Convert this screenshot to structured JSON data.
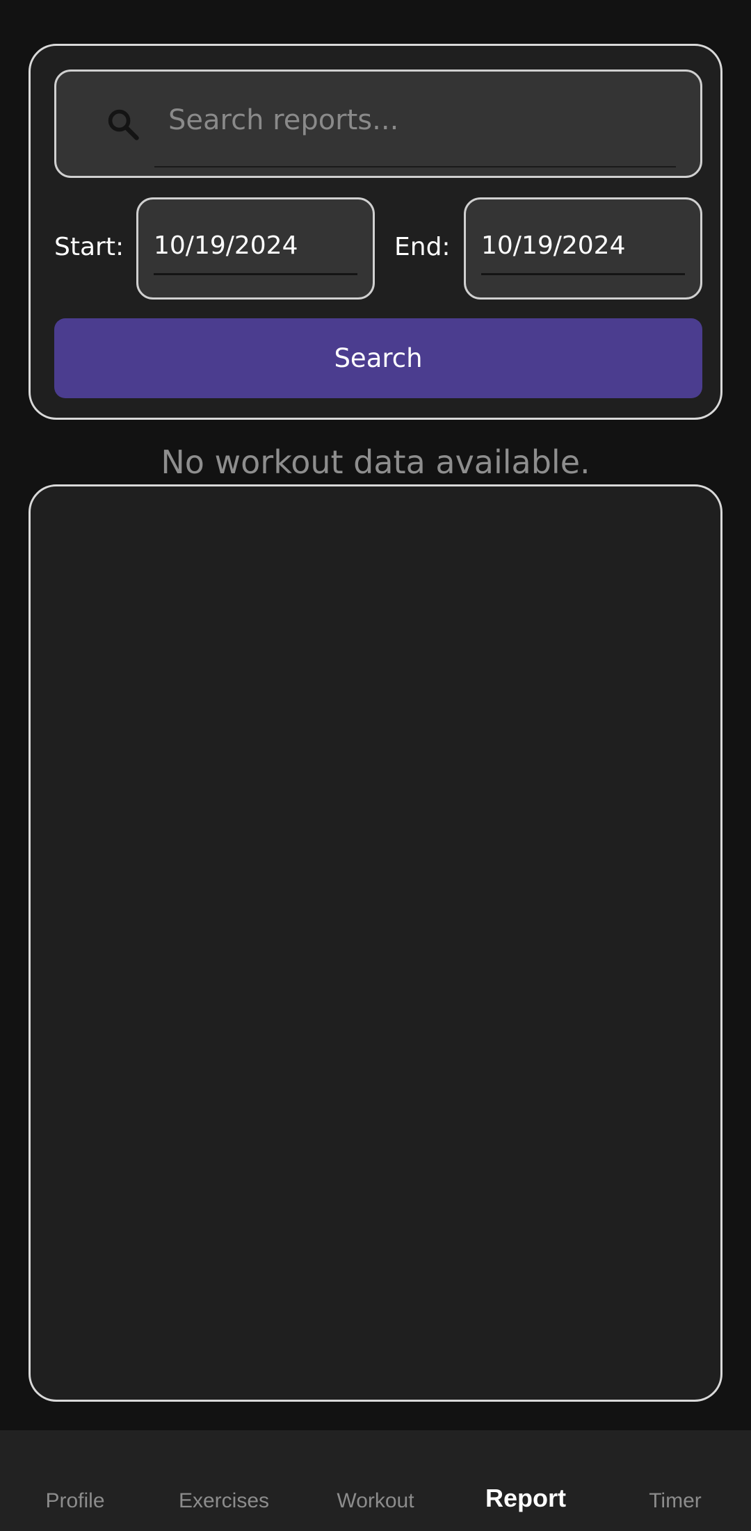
{
  "search": {
    "placeholder": "Search reports...",
    "value": ""
  },
  "date_range": {
    "start_label": "Start:",
    "start_value": "10/19/2024",
    "end_label": "End:",
    "end_value": "10/19/2024"
  },
  "search_button_label": "Search",
  "empty_message": "No workout data available.",
  "colors": {
    "accent": "#4b3d8f",
    "background": "#121212",
    "card": "#1f1f1f",
    "field": "#343434"
  },
  "bottom_nav": {
    "items": [
      {
        "label": "Profile",
        "active": false
      },
      {
        "label": "Exercises",
        "active": false
      },
      {
        "label": "Workout",
        "active": false
      },
      {
        "label": "Report",
        "active": true
      },
      {
        "label": "Timer",
        "active": false
      }
    ]
  }
}
